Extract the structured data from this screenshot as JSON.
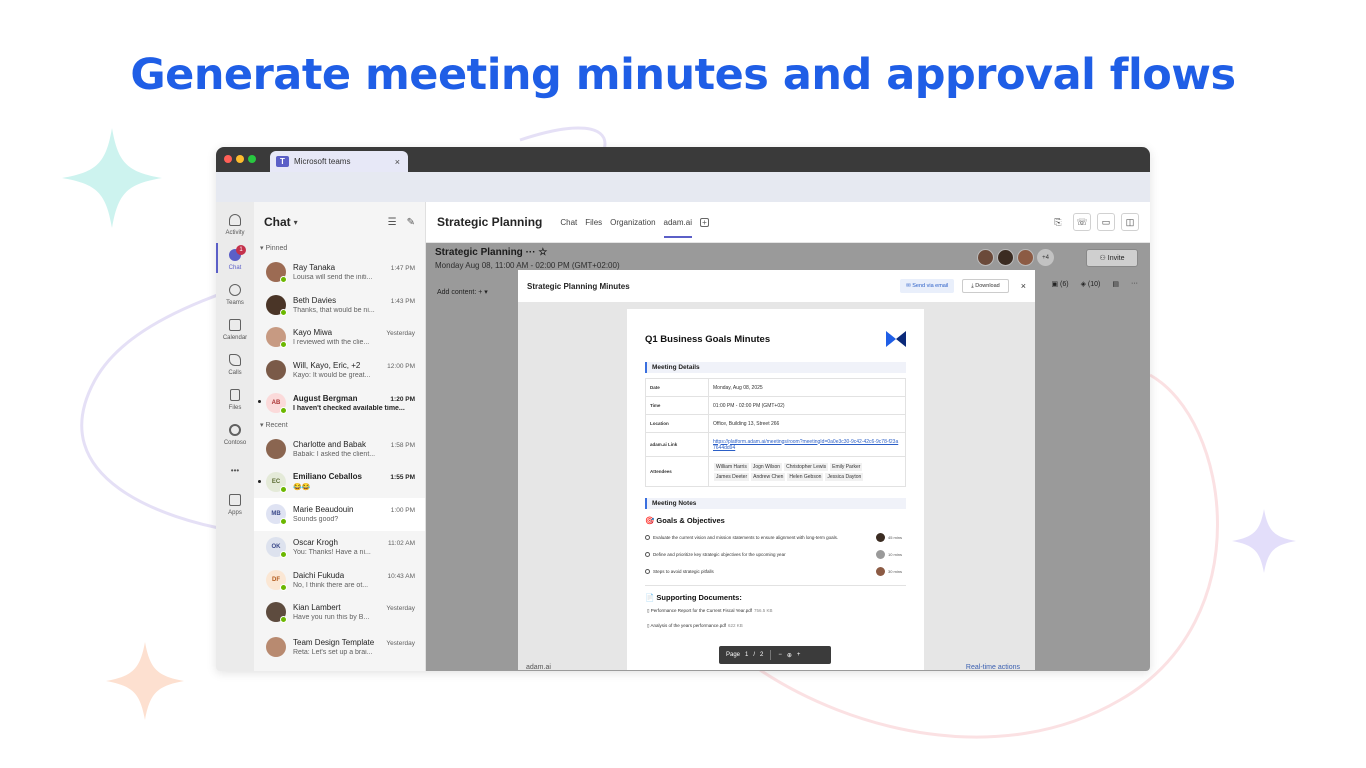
{
  "headline": "Generate meeting minutes and approval flows",
  "browser": {
    "tab_title": "Microsoft teams",
    "tab_close": "×"
  },
  "rail": [
    {
      "label": "Activity"
    },
    {
      "label": "Chat",
      "badge": "1"
    },
    {
      "label": "Teams"
    },
    {
      "label": "Calendar"
    },
    {
      "label": "Calls"
    },
    {
      "label": "Files"
    },
    {
      "label": "Contoso"
    },
    {
      "label": "•••"
    },
    {
      "label": "Apps"
    }
  ],
  "chat_list": {
    "title": "Chat",
    "pinned_label": "Pinned",
    "recent_label": "Recent",
    "pinned": [
      {
        "name": "Ray Tanaka",
        "time": "1:47 PM",
        "preview": "Louisa will send the initi..."
      },
      {
        "name": "Beth Davies",
        "time": "1:43 PM",
        "preview": "Thanks, that would be ni..."
      },
      {
        "name": "Kayo Miwa",
        "time": "Yesterday",
        "preview": "I reviewed with the clie..."
      },
      {
        "name": "Will, Kayo, Eric, +2",
        "time": "12:00 PM",
        "preview": "Kayo: It would be great..."
      },
      {
        "name": "August Bergman",
        "time": "1:20 PM",
        "preview": "I haven't checked available time...",
        "initials": "AB"
      }
    ],
    "recent": [
      {
        "name": "Charlotte and Babak",
        "time": "1:58 PM",
        "preview": "Babak: I asked the client..."
      },
      {
        "name": "Emiliano Ceballos",
        "time": "1:55 PM",
        "preview": "😂😂",
        "initials": "EC"
      },
      {
        "name": "Marie Beaudouin",
        "time": "1:00 PM",
        "preview": "Sounds good?",
        "initials": "MB"
      },
      {
        "name": "Oscar Krogh",
        "time": "11:02 AM",
        "preview": "You: Thanks! Have a ni...",
        "initials": "OK"
      },
      {
        "name": "Daichi Fukuda",
        "time": "10:43 AM",
        "preview": "No, I think there are ot...",
        "initials": "DF"
      },
      {
        "name": "Kian Lambert",
        "time": "Yesterday",
        "preview": "Have you run this by B..."
      },
      {
        "name": "Team Design Template",
        "time": "Yesterday",
        "preview": "Reta: Let's set up a brai..."
      }
    ]
  },
  "main": {
    "channel_title": "Strategic Planning",
    "tabs": [
      "Chat",
      "Files",
      "Organization",
      "adam.ai"
    ],
    "meeting_title": "Strategic Planning",
    "meeting_time": "Monday Aug 08, 11:00 AM - 02:00 PM (GMT+02:00)",
    "add_content": "Add content:",
    "plus_more": "+4",
    "invite": "Invite",
    "tool_counts": [
      "(6)",
      "(10)"
    ]
  },
  "modal": {
    "title": "Strategic Planning Minutes",
    "send_email": "Send via email",
    "download": "Download",
    "close": "×",
    "doc": {
      "title": "Q1 Business Goals Minutes",
      "meeting_details": "Meeting Details",
      "details": [
        {
          "k": "Date",
          "v": "Monday, Aug 08, 2025"
        },
        {
          "k": "Time",
          "v": "01:00 PM - 02:00 PM (GMT+02)"
        },
        {
          "k": "Location",
          "v": "Office, Building 13, Street 266"
        },
        {
          "k": "adam.ai Link",
          "v": "https://platform.adam.ai/meetings/room?meetingId=0a0e3c30-9c42-42c6-9c78-f23a7644dd94"
        },
        {
          "k": "Attendees",
          "v": ""
        }
      ],
      "attendees": [
        "William Harris",
        "Jogn Wilson",
        "Christopher Lewis",
        "Emily Parker",
        "James Deeter",
        "Andrew Chen",
        "Helen Gebson",
        "Jessica Dayton"
      ],
      "meeting_notes": "Meeting Notes",
      "goals_heading": "🎯 Goals & Objectives",
      "goals": [
        {
          "text": "Evaluate the current vision and mission statements to ensure alignment with long-term goals.",
          "mins": "45 mins"
        },
        {
          "text": "Define and prioritize key strategic objectives for the upcoming year",
          "mins": "10 mins"
        },
        {
          "text": "Steps to avoid strategic pitfalls",
          "mins": "30 mins"
        }
      ],
      "supporting_heading": "📄 Supporting Documents:",
      "files": [
        {
          "name": "Performance Report for the Current Fiscal Year.pdf",
          "size": "756.5 KB"
        },
        {
          "name": "Analysis of the years performance.pdf",
          "size": "622 KB"
        }
      ]
    },
    "pager": {
      "label": "Page",
      "current": "1",
      "slash": "/",
      "total": "2"
    }
  },
  "footer_peek": {
    "left": "adam.ai",
    "right": "Real-time actions"
  },
  "colors": {
    "brand": "#1f5ee6",
    "teams": "#5b5fc7"
  }
}
